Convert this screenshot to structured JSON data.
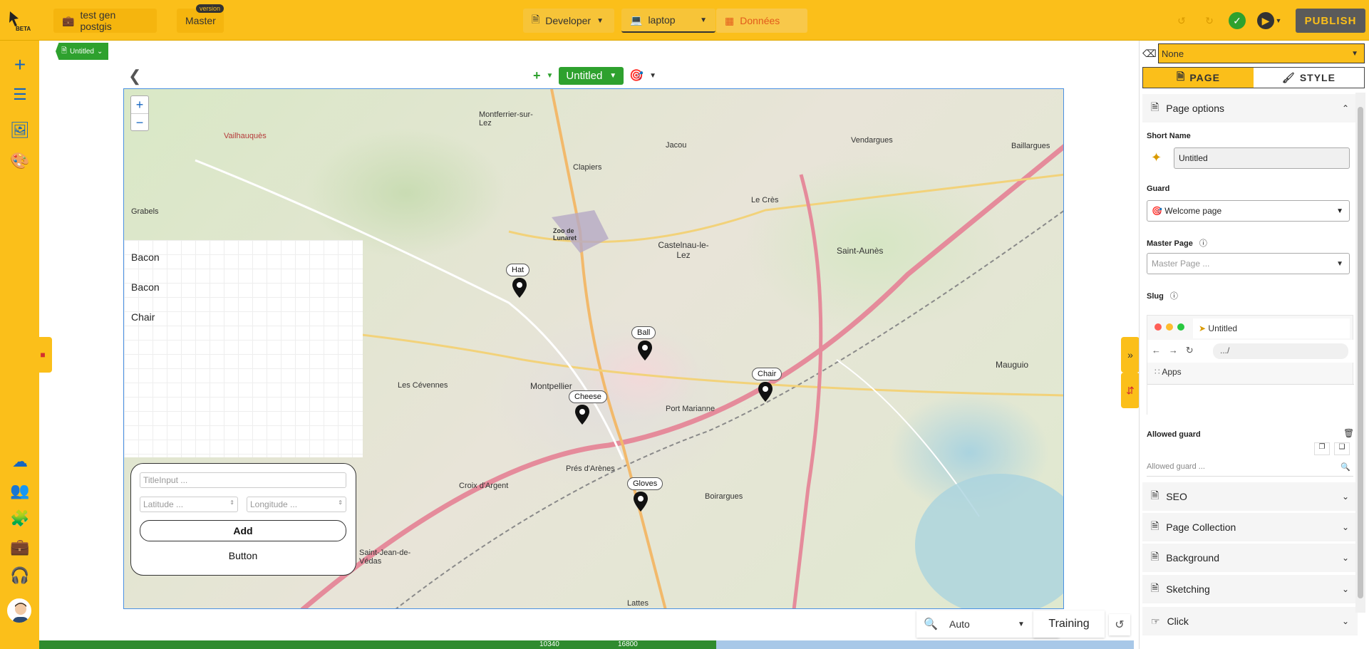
{
  "topbar": {
    "beta": "BETA",
    "project": "test gen postgis",
    "branch": "Master",
    "version_badge": "version",
    "role": "Developer",
    "device": "laptop",
    "data": "Données",
    "publish": "PUBLISH"
  },
  "canvas": {
    "page_chip": "Untitled",
    "page_name": "Untitled"
  },
  "map": {
    "labels": [
      "Montferrier-sur-Lez",
      "Clapiers",
      "Jacou",
      "Vendargues",
      "Baillargues",
      "Vailhauquès",
      "Grabels",
      "Montpellier",
      "Castelnau-le-Lez",
      "Saint-Aunès",
      "Mauguio",
      "Les Cévennes",
      "Port Marianne",
      "Croix d'Argent",
      "Prés d'Arènes",
      "Boirargues",
      "Saint-Jean-de-Védas",
      "Lattes",
      "Le Crès",
      "Zoo de Lunaret"
    ],
    "markers": [
      "Hat",
      "Ball",
      "Chair",
      "Cheese",
      "Gloves"
    ]
  },
  "list_items": [
    "Bacon",
    "Bacon",
    "Chair"
  ],
  "form": {
    "title_placeholder": "TitleInput ...",
    "lat_placeholder": "Latitude ...",
    "lon_placeholder": "Longitude ...",
    "add_label": "Add",
    "button_label": "Button"
  },
  "bottom": {
    "zoom_value": "Auto",
    "training": "Training",
    "timeline_a": "10340",
    "timeline_b": "16800"
  },
  "right": {
    "style_select": "None",
    "tab_page": "PAGE",
    "tab_style": "STYLE",
    "page_options": "Page options",
    "short_name_label": "Short Name",
    "short_name_value": "Untitled",
    "guard_label": "Guard",
    "guard_value": "Welcome page",
    "master_label": "Master Page",
    "master_placeholder": "Master Page ...",
    "slug_label": "Slug",
    "browser_tab": "Untitled",
    "browser_url": ".../",
    "browser_apps": "Apps",
    "allowed_label": "Allowed guard",
    "allowed_placeholder": "Allowed guard ...",
    "sections": [
      "SEO",
      "Page Collection",
      "Background",
      "Sketching",
      "Click"
    ]
  }
}
